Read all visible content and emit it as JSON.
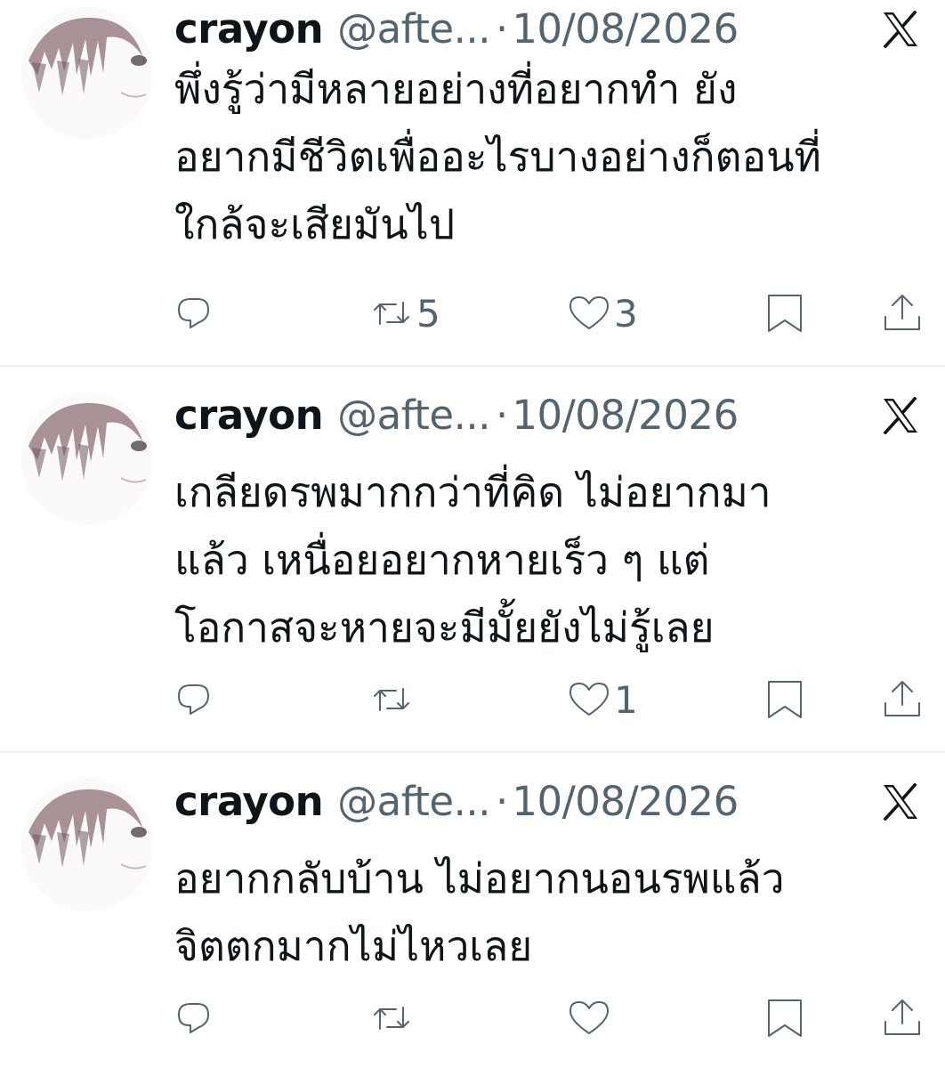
{
  "tweets": [
    {
      "display_name": "crayon",
      "handle": "@afte...",
      "separator": "·",
      "date": "10/08/2026",
      "text_lines": [
        "พึ่งรู้ว่ามีหลายอย่างที่อยากทำ ยัง",
        "อยากมีชีวิตเพื่ออะไรบางอย่างก็ตอนที่",
        "ใกล้จะเสียมันไป"
      ],
      "reposts": "5",
      "likes": "3"
    },
    {
      "display_name": "crayon",
      "handle": "@afte...",
      "separator": "·",
      "date": "10/08/2026",
      "text_lines": [
        "เกลียดรพมากกว่าที่คิด ไม่อยากมา",
        "แล้ว เหนื่อยอยากหายเร็ว ๆ แต่",
        "โอกาสจะหายจะมีมั้ยยังไม่รู้เลย"
      ],
      "reposts": "",
      "likes": "1"
    },
    {
      "display_name": "crayon",
      "handle": "@afte...",
      "separator": "·",
      "date": "10/08/2026",
      "text_lines": [
        "อยากกลับบ้าน ไม่อยากนอนรพแล้ว",
        "จิตตกมากไม่ไหวเลย"
      ],
      "reposts": "",
      "likes": ""
    }
  ],
  "icons": {
    "platform_logo": "x-logo-icon",
    "reply": "reply-icon",
    "repost": "repost-icon",
    "like": "heart-icon",
    "bookmark": "bookmark-icon",
    "share": "share-icon"
  },
  "colors": {
    "text_primary": "#0f1419",
    "text_secondary": "#536471",
    "divider": "#eff3f4"
  }
}
